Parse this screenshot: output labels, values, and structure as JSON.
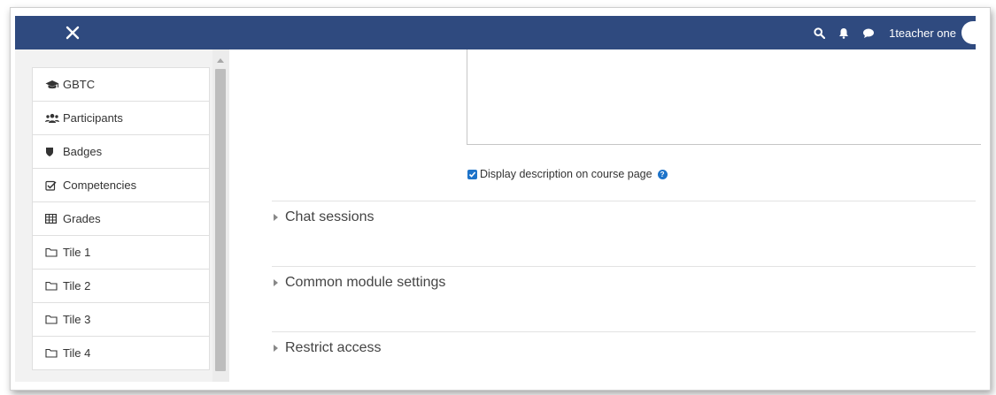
{
  "navbar": {
    "background": "#2f4a7f",
    "close_icon": "close-icon",
    "search_icon": "search-icon",
    "bell_icon": "bell-icon",
    "chat_icon": "chat-icon",
    "user_name": "1teacher one"
  },
  "sidebar": {
    "items": [
      {
        "label": "GBTC",
        "icon": "graduation-cap-icon"
      },
      {
        "label": "Participants",
        "icon": "users-icon"
      },
      {
        "label": "Badges",
        "icon": "shield-icon"
      },
      {
        "label": "Competencies",
        "icon": "check-square-icon"
      },
      {
        "label": "Grades",
        "icon": "table-icon"
      },
      {
        "label": "Tile 1",
        "icon": "folder-icon"
      },
      {
        "label": "Tile 2",
        "icon": "folder-icon"
      },
      {
        "label": "Tile 3",
        "icon": "folder-icon"
      },
      {
        "label": "Tile 4",
        "icon": "folder-icon"
      }
    ]
  },
  "form": {
    "display_description": {
      "label": "Display description on course page",
      "checked": true,
      "accent": "#1d73c9"
    },
    "sections": [
      {
        "label": "Chat sessions"
      },
      {
        "label": "Common module settings"
      },
      {
        "label": "Restrict access"
      }
    ]
  }
}
